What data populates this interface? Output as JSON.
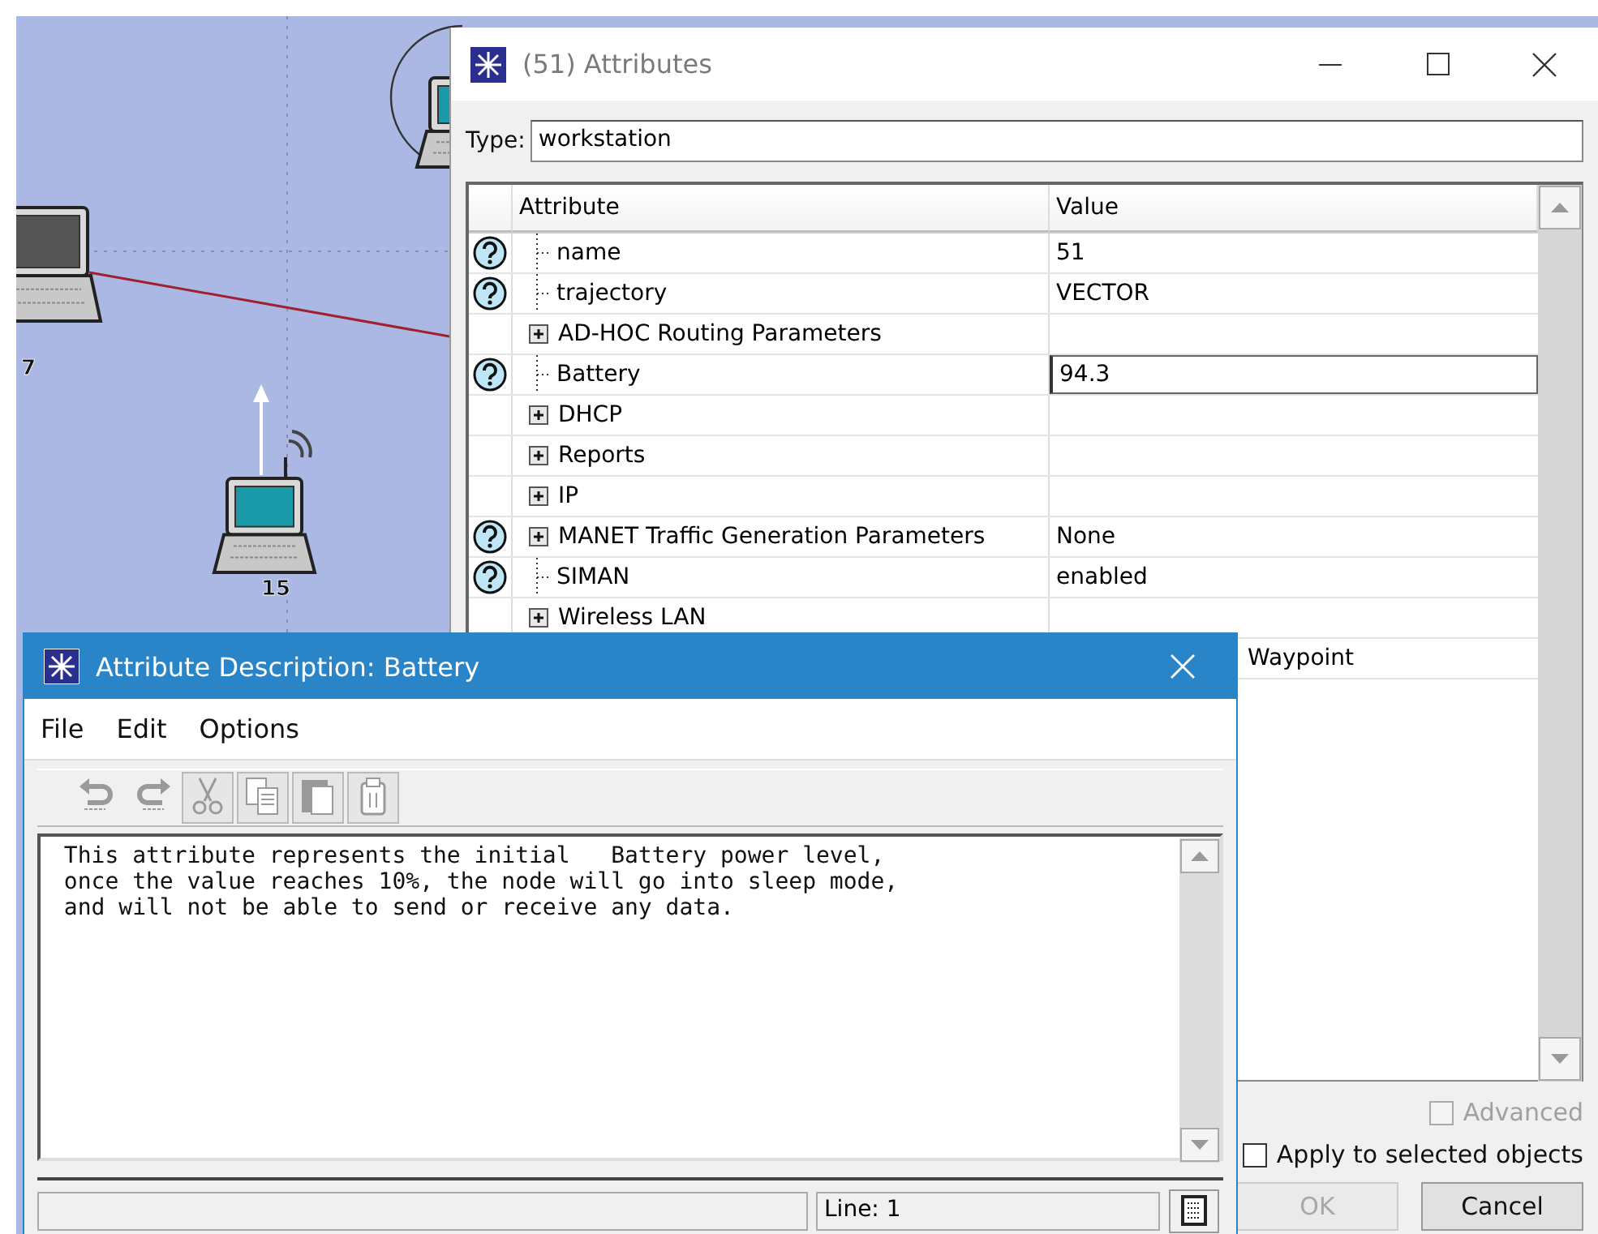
{
  "canvas": {
    "nodes": [
      {
        "label": "7",
        "kind": "laptop-large"
      },
      {
        "label": "15",
        "kind": "laptop-wireless"
      },
      {
        "kind": "laptop-ringed"
      }
    ]
  },
  "attributes_window": {
    "title": "(51) Attributes",
    "type_label": "Type:",
    "type_value": "workstation",
    "table": {
      "columns": [
        "Attribute",
        "Value"
      ],
      "rows": [
        {
          "name": "name",
          "value": "51",
          "help": true,
          "kind": "leaf",
          "editing": false
        },
        {
          "name": "trajectory",
          "value": "VECTOR",
          "help": true,
          "kind": "leaf",
          "editing": false
        },
        {
          "name": "AD-HOC Routing Parameters",
          "help": false,
          "kind": "group",
          "editing": false
        },
        {
          "name": "Battery",
          "value": "94.3",
          "help": true,
          "kind": "leaf",
          "editing": true
        },
        {
          "name": "DHCP",
          "help": false,
          "kind": "group",
          "editing": false
        },
        {
          "name": "Reports",
          "help": false,
          "kind": "group",
          "editing": false
        },
        {
          "name": "IP",
          "help": false,
          "kind": "group",
          "editing": false
        },
        {
          "name": "MANET Traffic Generation Parameters",
          "value": "None",
          "help": true,
          "kind": "group",
          "editing": false
        },
        {
          "name": "SIMAN",
          "value": "enabled",
          "help": true,
          "kind": "leaf",
          "editing": false
        },
        {
          "name": "Wireless LAN",
          "help": false,
          "kind": "group",
          "editing": false
        },
        {
          "value": "Waypoint",
          "help": false,
          "kind": "hidden",
          "editing": false
        }
      ]
    },
    "advanced": {
      "label": "Advanced",
      "checked": false,
      "disabled": true
    },
    "apply": {
      "label": "Apply to selected objects",
      "checked": false,
      "disabled": false
    },
    "buttons": [
      {
        "label": "OK",
        "disabled": true
      },
      {
        "label": "Cancel",
        "disabled": false
      }
    ]
  },
  "description_window": {
    "title": "Attribute Description: Battery",
    "menu": [
      "File",
      "Edit",
      "Options"
    ],
    "toolbar": [
      {
        "kind": "undo",
        "disabled": true
      },
      {
        "kind": "redo",
        "disabled": true
      },
      {
        "kind": "cut",
        "disabled": true
      },
      {
        "kind": "copy",
        "disabled": true
      },
      {
        "kind": "paste",
        "disabled": true
      },
      {
        "kind": "clear",
        "disabled": true
      }
    ],
    "text": " This attribute represents the initial   Battery power level,\n once the value reaches 10%, the node will go into sleep mode,\n and will not be able to send or receive any data.",
    "status": {
      "line": "Line: 1"
    }
  }
}
